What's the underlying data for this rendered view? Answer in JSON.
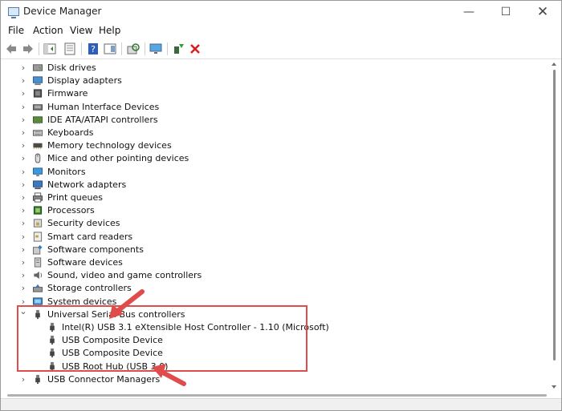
{
  "window": {
    "title": "Device Manager",
    "min_glyph": "—",
    "max_glyph": "☐",
    "close_glyph": "✕"
  },
  "menu": {
    "file": "File",
    "action": "Action",
    "view": "View",
    "help": "Help"
  },
  "toolbar": {
    "buttons": [
      "back-icon",
      "forward-icon",
      "properties-pane-icon",
      "list-icon",
      "help-icon",
      "console-tree-icon",
      "scan-icon",
      "monitor-icon",
      "enable-device-icon",
      "uninstall-icon"
    ]
  },
  "tree": {
    "categories": [
      {
        "label": "Disk drives",
        "icon": "disk-icon",
        "expanded": false
      },
      {
        "label": "Display adapters",
        "icon": "display-icon",
        "expanded": false
      },
      {
        "label": "Firmware",
        "icon": "firmware-icon",
        "expanded": false
      },
      {
        "label": "Human Interface Devices",
        "icon": "hid-icon",
        "expanded": false
      },
      {
        "label": "IDE ATA/ATAPI controllers",
        "icon": "ide-icon",
        "expanded": false
      },
      {
        "label": "Keyboards",
        "icon": "keyboard-icon",
        "expanded": false
      },
      {
        "label": "Memory technology devices",
        "icon": "memory-icon",
        "expanded": false
      },
      {
        "label": "Mice and other pointing devices",
        "icon": "mouse-icon",
        "expanded": false
      },
      {
        "label": "Monitors",
        "icon": "monitor-icon",
        "expanded": false
      },
      {
        "label": "Network adapters",
        "icon": "network-icon",
        "expanded": false
      },
      {
        "label": "Print queues",
        "icon": "printer-icon",
        "expanded": false
      },
      {
        "label": "Processors",
        "icon": "processor-icon",
        "expanded": false
      },
      {
        "label": "Security devices",
        "icon": "security-icon",
        "expanded": false
      },
      {
        "label": "Smart card readers",
        "icon": "smartcard-icon",
        "expanded": false
      },
      {
        "label": "Software components",
        "icon": "software-component-icon",
        "expanded": false
      },
      {
        "label": "Software devices",
        "icon": "software-device-icon",
        "expanded": false
      },
      {
        "label": "Sound, video and game controllers",
        "icon": "sound-icon",
        "expanded": false
      },
      {
        "label": "Storage controllers",
        "icon": "storage-icon",
        "expanded": false
      },
      {
        "label": "System devices",
        "icon": "system-icon",
        "expanded": false
      },
      {
        "label": "Universal Serial Bus controllers",
        "icon": "usb-icon",
        "expanded": true,
        "children": [
          "Intel(R) USB 3.1 eXtensible Host Controller - 1.10 (Microsoft)",
          "USB Composite Device",
          "USB Composite Device",
          "USB Root Hub (USB 3.0)"
        ]
      },
      {
        "label": "USB Connector Managers",
        "icon": "usb-icon",
        "expanded": false
      }
    ]
  },
  "colors": {
    "annotation": "#e04b4b",
    "chevron": "#555555"
  }
}
